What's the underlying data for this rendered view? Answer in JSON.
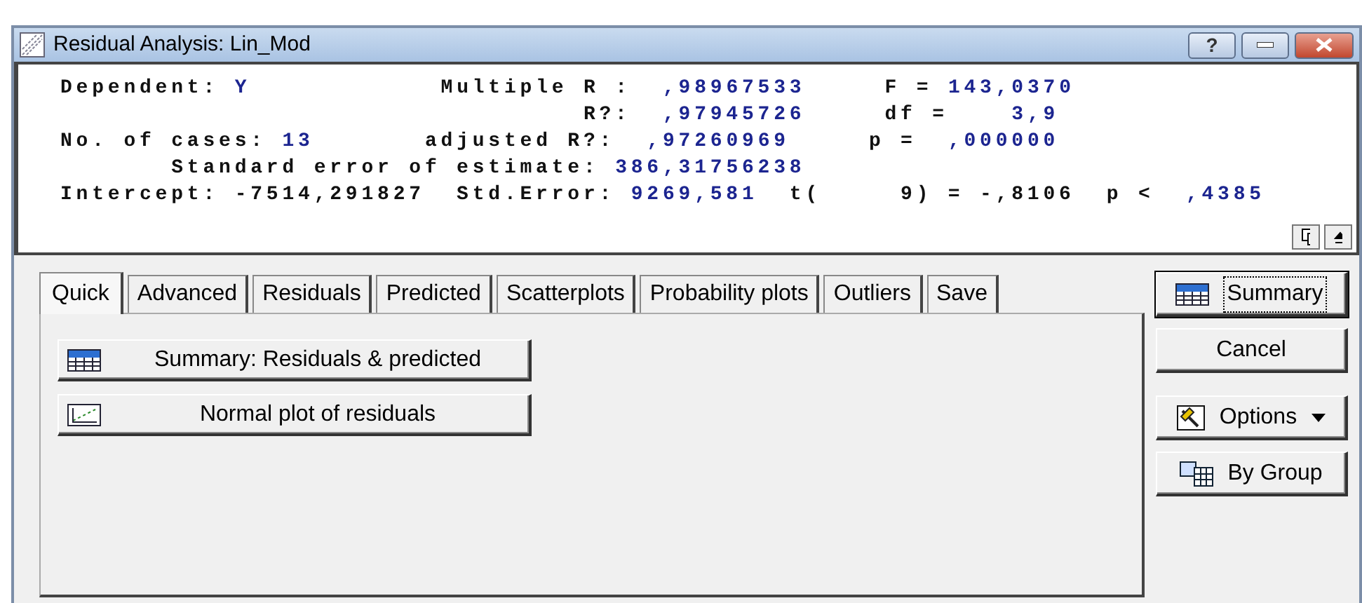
{
  "window": {
    "title": "Residual Analysis: Lin_Mod",
    "controls": [
      {
        "kind": "help",
        "label": "?"
      },
      {
        "kind": "minimize"
      },
      {
        "kind": "close"
      }
    ]
  },
  "results": [
    [
      {
        "kind": "label",
        "text": "Dependent:"
      },
      {
        "kind": "value",
        "text": " Y"
      },
      {
        "kind": "label",
        "text": "            Multiple R :"
      },
      {
        "kind": "value",
        "text": "  ,98967533"
      },
      {
        "kind": "label",
        "text": "     F ="
      },
      {
        "kind": "value",
        "text": " 143,0370"
      }
    ],
    [
      {
        "kind": "label",
        "text": "                                 R?:"
      },
      {
        "kind": "value",
        "text": "  ,97945726"
      },
      {
        "kind": "label",
        "text": "     df ="
      },
      {
        "kind": "value",
        "text": "    3,9"
      }
    ],
    [
      {
        "kind": "label",
        "text": "No. of cases:"
      },
      {
        "kind": "value",
        "text": " 13"
      },
      {
        "kind": "label",
        "text": "       adjusted R?:"
      },
      {
        "kind": "value",
        "text": "  ,97260969"
      },
      {
        "kind": "label",
        "text": "     p ="
      },
      {
        "kind": "value",
        "text": "  ,000000"
      }
    ],
    [
      {
        "kind": "label",
        "text": "       Standard error of estimate:"
      },
      {
        "kind": "value",
        "text": " 386,31756238"
      }
    ],
    [
      {
        "kind": "label",
        "text": "Intercept: -7514,291827  Std.Error:"
      },
      {
        "kind": "value",
        "text": " 9269,581"
      },
      {
        "kind": "label",
        "text": "  t(     9) = -,8106  p <"
      },
      {
        "kind": "value",
        "text": "  ,4385"
      }
    ]
  ],
  "tabs": [
    {
      "label": "Quick",
      "selected": true
    },
    {
      "label": "Advanced",
      "selected": false
    },
    {
      "label": "Residuals",
      "selected": false
    },
    {
      "label": "Predicted",
      "selected": false
    },
    {
      "label": "Scatterplots",
      "selected": false
    },
    {
      "label": "Probability plots",
      "selected": false
    },
    {
      "label": "Outliers",
      "selected": false
    },
    {
      "label": "Save",
      "selected": false
    }
  ],
  "quick_buttons": [
    {
      "label": "Summary:  Residuals & predicted",
      "kind": "table"
    },
    {
      "label": "Normal plot of residuals",
      "kind": "plot"
    }
  ],
  "side_buttons": [
    {
      "label": "Summary",
      "kind": "table",
      "default": true
    },
    {
      "label": "Cancel",
      "kind": "plain"
    },
    {
      "label": "Options",
      "kind": "options",
      "dropdown": true
    },
    {
      "label": "By Group",
      "kind": "bygroup"
    }
  ]
}
